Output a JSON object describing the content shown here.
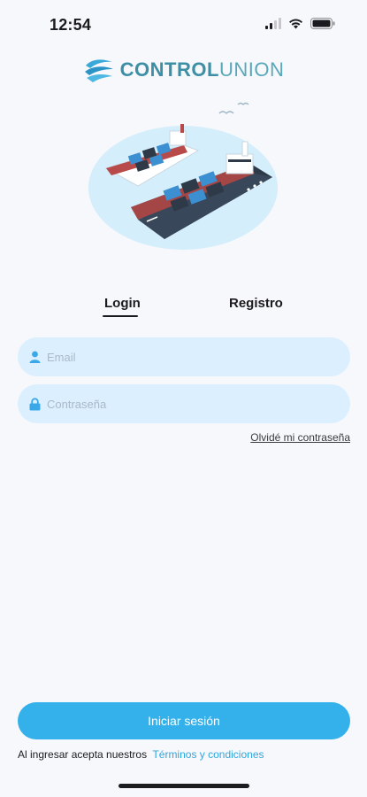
{
  "status_bar": {
    "time": "12:54",
    "icons": [
      "signal-icon",
      "wifi-icon",
      "battery-icon"
    ]
  },
  "logo": {
    "bold": "CONTROL",
    "light": "UNION",
    "brand_color": "#3d8fa6"
  },
  "hero": {
    "icon": "cargo-ships-illustration"
  },
  "tabs": {
    "login": "Login",
    "register": "Registro",
    "active": "login"
  },
  "form": {
    "email_placeholder": "Email",
    "email_value": "",
    "password_placeholder": "Contraseña",
    "password_value": "",
    "forgot_label": "Olvidé mi contraseña"
  },
  "footer": {
    "login_button": "Iniciar sesión",
    "terms_prefix": "Al ingresar acepta nuestros",
    "terms_link": "Términos y condiciones"
  },
  "colors": {
    "accent": "#34b1ea",
    "input_bg": "#dcefff",
    "link": "#2fa6de",
    "background": "#f6f8fb"
  }
}
